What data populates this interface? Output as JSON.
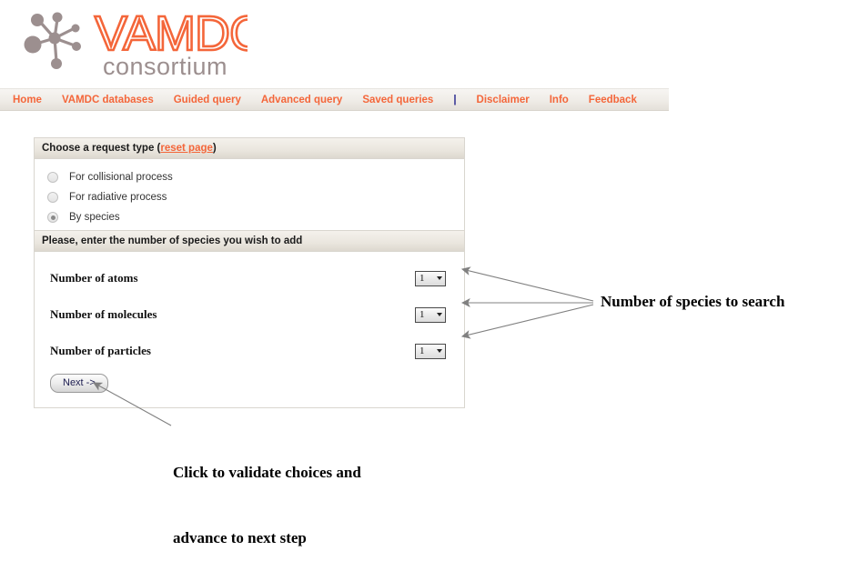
{
  "logo": {
    "wordmark": "VAMDC",
    "subtitle": "consortium",
    "icon_name": "vamdc-node-starburst-logo",
    "accent_color": "#f4663a",
    "node_color": "#9c8f8f"
  },
  "nav": {
    "items": [
      {
        "label": "Home",
        "name": "nav-home"
      },
      {
        "label": "VAMDC databases",
        "name": "nav-vamdc-databases"
      },
      {
        "label": "Guided query",
        "name": "nav-guided-query"
      },
      {
        "label": "Advanced query",
        "name": "nav-advanced-query"
      },
      {
        "label": "Saved queries",
        "name": "nav-saved-queries"
      },
      {
        "label": "|",
        "name": "nav-separator"
      },
      {
        "label": "Disclaimer",
        "name": "nav-disclaimer"
      },
      {
        "label": "Info",
        "name": "nav-info"
      },
      {
        "label": "Feedback",
        "name": "nav-feedback"
      }
    ],
    "link_color": "#f4663a",
    "separator_color": "#2b2b8f"
  },
  "request_panel": {
    "header_text": "Choose a request type (",
    "header_link": "reset page",
    "header_text_end": ")",
    "options": [
      {
        "label": "For collisional process",
        "checked": false
      },
      {
        "label": "For radiative process",
        "checked": false
      },
      {
        "label": "By species",
        "checked": true
      }
    ]
  },
  "species_panel": {
    "header": "Please, enter the number of species you wish to add",
    "rows": [
      {
        "label": "Number of atoms",
        "value": "1"
      },
      {
        "label": "Number of molecules",
        "value": "1"
      },
      {
        "label": "Number of particles",
        "value": "1"
      }
    ],
    "next_button": "Next ->"
  },
  "annotations": {
    "species": "Number of species to search",
    "next_line1": "Click to validate choices and",
    "next_line2": "advance to next step",
    "arrow_color": "#808080"
  }
}
